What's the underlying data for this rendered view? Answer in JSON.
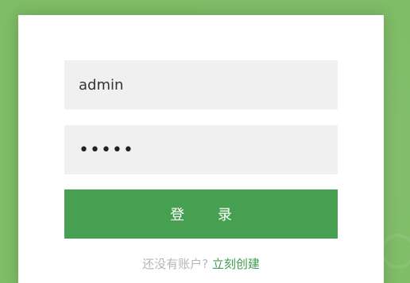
{
  "login": {
    "username_value": "admin",
    "password_value": "•••••",
    "submit_label": "登 录",
    "signup_prompt": "还没有账户?",
    "signup_link": "立刻创建"
  },
  "colors": {
    "background": "#7fbd66",
    "accent": "#47a052",
    "field_background": "#f0f0f0"
  }
}
